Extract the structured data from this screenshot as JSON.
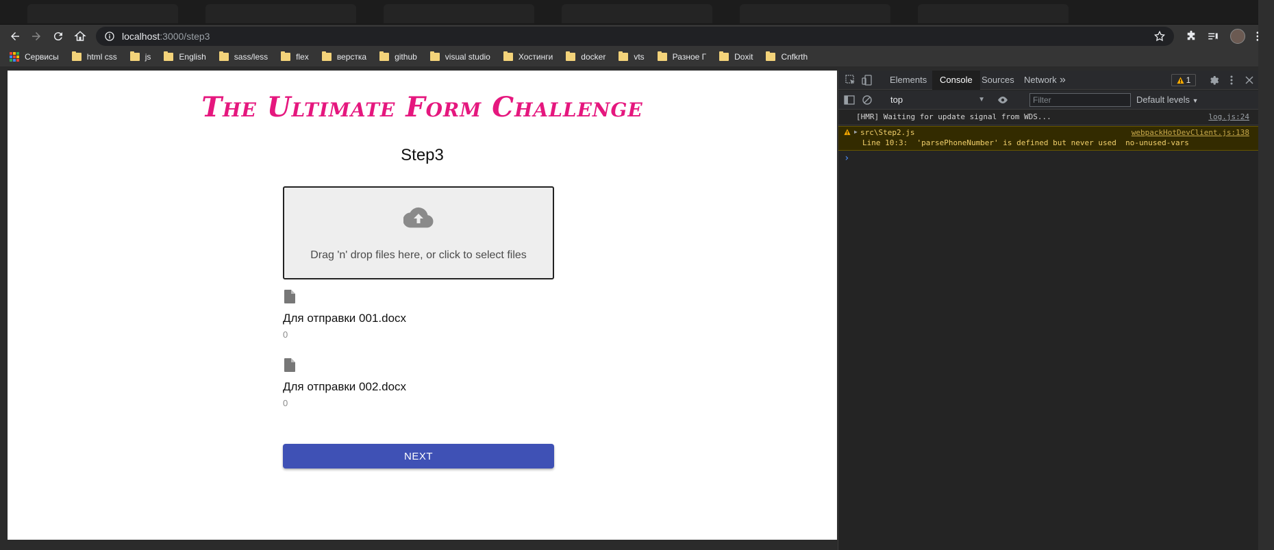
{
  "browser": {
    "url_host": "localhost",
    "url_path": ":3000/step3",
    "bookmarks": [
      {
        "label": "Сервисы",
        "type": "apps"
      },
      {
        "label": "html css",
        "type": "folder"
      },
      {
        "label": "js",
        "type": "folder"
      },
      {
        "label": "English",
        "type": "folder"
      },
      {
        "label": "sass/less",
        "type": "folder"
      },
      {
        "label": "flex",
        "type": "folder"
      },
      {
        "label": "верстка",
        "type": "folder"
      },
      {
        "label": "github",
        "type": "folder"
      },
      {
        "label": "visual studio",
        "type": "folder"
      },
      {
        "label": "Хостинги",
        "type": "folder"
      },
      {
        "label": "docker",
        "type": "folder"
      },
      {
        "label": "vts",
        "type": "folder"
      },
      {
        "label": "Разное Г",
        "type": "folder"
      },
      {
        "label": "Doxit",
        "type": "folder"
      },
      {
        "label": "Cnfkrth",
        "type": "folder"
      }
    ]
  },
  "page": {
    "title": "The Ultimate Form Challenge",
    "step_title": "Step3",
    "dropzone_text": "Drag 'n' drop files here, or click to select files",
    "files": [
      {
        "name": "Для отправки 001.docx",
        "size": "0"
      },
      {
        "name": "Для отправки 002.docx",
        "size": "0"
      }
    ],
    "next_label": "NEXT"
  },
  "devtools": {
    "tabs": [
      "Elements",
      "Console",
      "Sources",
      "Network"
    ],
    "active_tab": "Console",
    "more_tabs": "»",
    "warning_count": "1",
    "context": "top",
    "filter_placeholder": "Filter",
    "levels_label": "Default levels",
    "logs": [
      {
        "type": "info",
        "message": "[HMR] Waiting for update signal from WDS...",
        "source": "log.js:24"
      },
      {
        "type": "warning",
        "file": "src\\Step2.js",
        "detail": "Line 10:3:  'parsePhoneNumber' is defined but never used  no-unused-vars",
        "source": "webpackHotDevClient.js:138"
      }
    ],
    "prompt": "›"
  },
  "colors": {
    "title_pink": "#e5177e",
    "primary_button": "#3f51b5",
    "dropzone_bg": "#eeeeee",
    "warning_bg": "#332b00",
    "warning_text": "#f2d06b"
  },
  "icons": [
    "back-icon",
    "forward-icon",
    "reload-icon",
    "home-icon",
    "info-icon",
    "star-icon",
    "puzzle-icon",
    "reading-list-icon",
    "menu-icon",
    "cloud-upload-icon",
    "document-icon",
    "inspect-icon",
    "device-icon",
    "gear-icon",
    "kebab-icon",
    "close-icon",
    "sidebar-icon",
    "clear-console-icon",
    "eye-icon",
    "warning-icon"
  ]
}
